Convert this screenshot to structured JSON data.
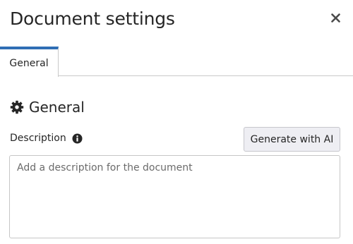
{
  "dialog": {
    "title": "Document settings",
    "close_icon": "close-icon"
  },
  "tabs": [
    {
      "label": "General",
      "active": true
    }
  ],
  "section": {
    "heading": "General",
    "icon": "gear-icon"
  },
  "description_field": {
    "label": "Description",
    "info_icon": "info-icon",
    "placeholder": "Add a description for the document",
    "value": ""
  },
  "generate_button": {
    "label": "Generate with AI"
  },
  "colors": {
    "accent": "#2f6eb5",
    "text": "#262626",
    "button_bg": "#eeeef3",
    "border": "#c9c9c9"
  }
}
